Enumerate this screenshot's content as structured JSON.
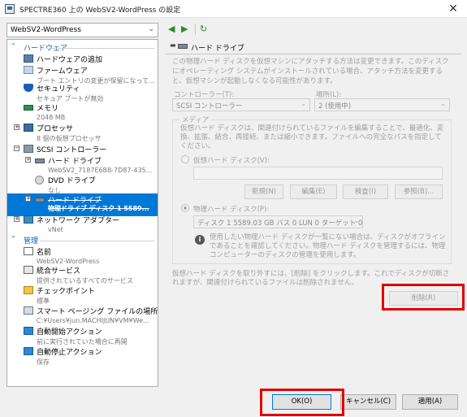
{
  "window": {
    "title": "SPECTRE360 上の WebSV2-WordPress の設定",
    "close_glyph": "✕"
  },
  "vm_selector": {
    "value": "WebSV2-WordPress"
  },
  "sections": {
    "hardware": "ハードウェア",
    "management": "管理"
  },
  "tree": {
    "add_hardware": "ハードウェアの追加",
    "firmware": {
      "label": "ファームウェア",
      "sub": "ブート エントリの変更が保留になって..."
    },
    "security": {
      "label": "セキュリティ",
      "sub": "セキュア ブートが無効"
    },
    "memory": {
      "label": "メモリ",
      "sub": "2048 MB"
    },
    "processor": {
      "label": "プロセッサ",
      "sub": "8 個の仮想プロセッサ"
    },
    "scsi": {
      "label": "SCSI コントローラー"
    },
    "hdd1": {
      "label": "ハード ドライブ",
      "sub": "WebSV2_7187E6B8-7D87-435..."
    },
    "dvd": {
      "label": "DVD ドライブ",
      "sub": "なし"
    },
    "hdd2": {
      "label": "ハード ドライブ",
      "sub": "物理ドライブ ディスク 1 5589..."
    },
    "network": {
      "label": "ネットワーク アダプター",
      "sub": "vNet"
    },
    "name": {
      "label": "名前",
      "sub": "WebSV2-WordPress"
    },
    "integration": {
      "label": "統合サービス",
      "sub": "提供されているすべてのサービス"
    },
    "checkpoint": {
      "label": "チェックポイント",
      "sub": "標準"
    },
    "paging": {
      "label": "スマート ページング ファイルの場所",
      "sub": "C:¥Users¥jun.MACHIJUN¥VM¥We..."
    },
    "auto_start": {
      "label": "自動開始アクション",
      "sub": "前に実行されていた場合に再開"
    },
    "auto_stop": {
      "label": "自動停止アクション",
      "sub": "保存"
    }
  },
  "panel": {
    "header": "ハード ドライブ",
    "description": "この物理ハード ディスクを仮想マシンにアタッチする方法は変更できます。このディスクにオペレーティング システムがインストールされている場合、アタッチ方法を変更すると、仮想マシンが起動しなくなる可能性があります。",
    "controller_label": "コントローラー(T):",
    "controller_value": "SCSI コントローラー",
    "location_label": "場所(L):",
    "location_value": "2 (使用中)",
    "media_legend": "メディア",
    "media_desc": "仮想ハード ディスクは、関連付けられているファイルを編集することで、最適化、変換、拡張、結合、再接続、または縮小できます。ファイルへの完全なパスを指定してください。",
    "virtual_disk_label": "仮想ハード ディスク(V):",
    "buttons": {
      "new": "新規(N)",
      "edit": "編集(E)",
      "inspect": "検査(I)",
      "browse": "参照(B)..."
    },
    "physical_disk_label": "物理ハード ディスク(P):",
    "physical_disk_value": "ディスク 1 5589.03 GB バス 0 LUN 0 ターゲット 0",
    "info_text": "使用したい物理ハード ディスクが一覧にない場合は、ディスクがオフラインであることを確認してください。物理ハード ディスクを管理するには、物理コンピューターのディスクの管理を使用します。",
    "remove_text": "仮想ハード ディスクを取り外すには、[削除] をクリックします。これでディスクが切断されますが、関連付けられているファイルは削除されません。",
    "remove_button": "削除(R)"
  },
  "footer": {
    "ok": "OK(O)",
    "cancel": "キャンセル(C)",
    "apply": "適用(A)"
  },
  "colors": {
    "selection": "#0078d7",
    "section_header": "#0063b1",
    "highlight_box": "#e00000"
  }
}
